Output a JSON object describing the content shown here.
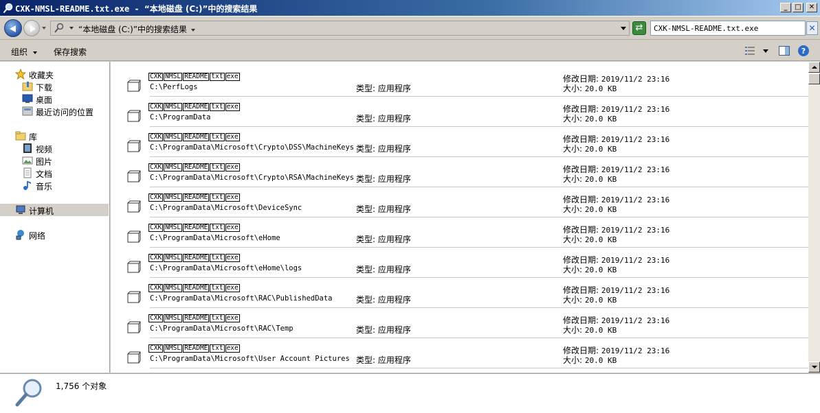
{
  "window": {
    "title_file": "CXK-NMSL-README.txt.exe",
    "title_sep": " - ",
    "title_location": "“本地磁盘 (C:)”中的搜索结果",
    "minimize_label": "_",
    "maximize_label": "□",
    "close_label": "✕"
  },
  "address": {
    "path_text": "“本地磁盘 (C:)”中的搜索结果",
    "search_value": "CXK-NMSL-README.txt.exe",
    "refresh_label": "⇄",
    "clear_label": "✕"
  },
  "toolbar": {
    "organize_label": "组织",
    "save_search_label": "保存搜索"
  },
  "nav": {
    "favorites": {
      "label": "收藏夹",
      "icon": "star-icon"
    },
    "favorites_items": [
      {
        "label": "下载",
        "icon": "download-folder-icon"
      },
      {
        "label": "桌面",
        "icon": "desktop-icon"
      },
      {
        "label": "最近访问的位置",
        "icon": "recent-places-icon"
      }
    ],
    "libraries": {
      "label": "库",
      "icon": "library-icon"
    },
    "libraries_items": [
      {
        "label": "视频",
        "icon": "video-icon"
      },
      {
        "label": "图片",
        "icon": "picture-icon"
      },
      {
        "label": "文档",
        "icon": "document-icon"
      },
      {
        "label": "音乐",
        "icon": "music-icon"
      }
    ],
    "computer": {
      "label": "计算机",
      "icon": "computer-icon"
    },
    "network": {
      "label": "网络",
      "icon": "network-icon"
    }
  },
  "results": {
    "name_parts": [
      "CXK",
      "NMSL",
      "README",
      "txt",
      "exe"
    ],
    "type_label": "类型:",
    "type_value": "应用程序",
    "date_label": "修改日期:",
    "size_label": "大小:",
    "items": [
      {
        "path": "C:\\PerfLogs",
        "date": "2019/11/2 23:16",
        "size": "20.0 KB"
      },
      {
        "path": "C:\\ProgramData",
        "date": "2019/11/2 23:16",
        "size": "20.0 KB"
      },
      {
        "path": "C:\\ProgramData\\Microsoft\\Crypto\\DSS\\MachineKeys",
        "date": "2019/11/2 23:16",
        "size": "20.0 KB"
      },
      {
        "path": "C:\\ProgramData\\Microsoft\\Crypto\\RSA\\MachineKeys",
        "date": "2019/11/2 23:16",
        "size": "20.0 KB"
      },
      {
        "path": "C:\\ProgramData\\Microsoft\\DeviceSync",
        "date": "2019/11/2 23:16",
        "size": "20.0 KB"
      },
      {
        "path": "C:\\ProgramData\\Microsoft\\eHome",
        "date": "2019/11/2 23:16",
        "size": "20.0 KB"
      },
      {
        "path": "C:\\ProgramData\\Microsoft\\eHome\\logs",
        "date": "2019/11/2 23:16",
        "size": "20.0 KB"
      },
      {
        "path": "C:\\ProgramData\\Microsoft\\RAC\\PublishedData",
        "date": "2019/11/2 23:16",
        "size": "20.0 KB"
      },
      {
        "path": "C:\\ProgramData\\Microsoft\\RAC\\Temp",
        "date": "2019/11/2 23:16",
        "size": "20.0 KB"
      },
      {
        "path": "C:\\ProgramData\\Microsoft\\User Account Pictures",
        "date": "2019/11/2 23:16",
        "size": "20.0 KB"
      }
    ]
  },
  "status": {
    "count_text": "1,756 个对象"
  },
  "colors": {
    "accent": "#2a5aa8",
    "title_bar": "#0a246a",
    "chrome": "#d4d0c8"
  }
}
